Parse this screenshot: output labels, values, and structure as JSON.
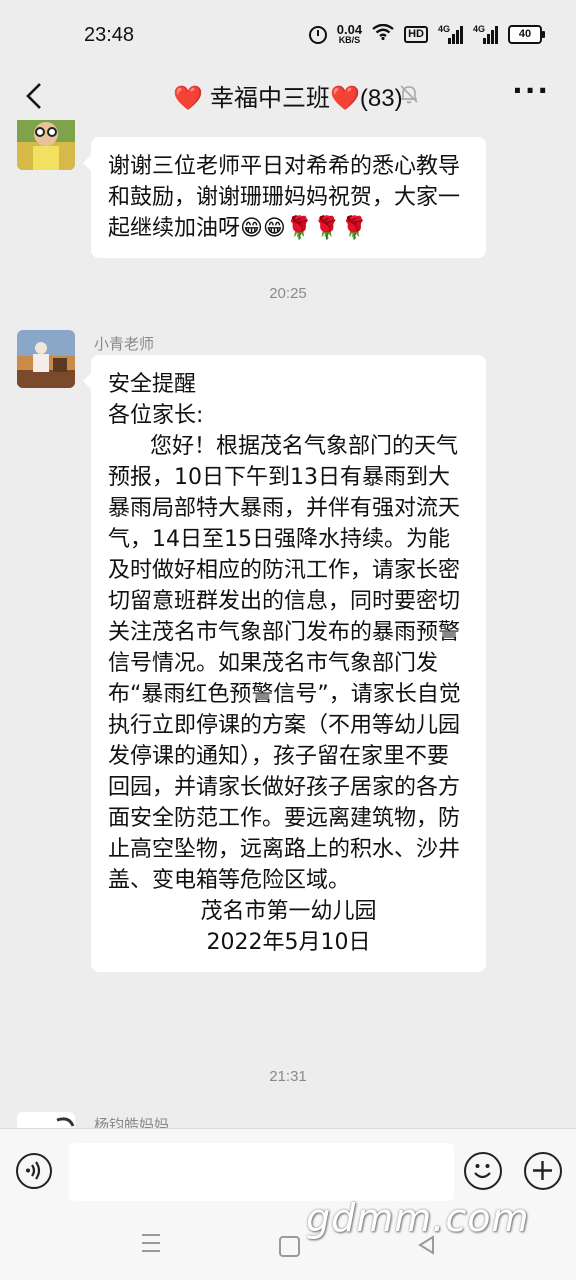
{
  "status_bar": {
    "time": "23:48",
    "net_speed_value": "0.04",
    "net_speed_unit": "KB/S",
    "hd_label": "HD",
    "sig1_label": "4G",
    "sig2_label": "4G",
    "battery": "40"
  },
  "header": {
    "title_heart_left": "❤️",
    "title_text": "幸福中三班",
    "title_heart_right": "❤️",
    "member_count": "(83)",
    "more_label": "···"
  },
  "messages": [
    {
      "sender": "",
      "text": "谢谢三位老师平日对希希的悉心教导和鼓励，谢谢珊珊妈妈祝贺，大家一起继续加油呀😁😁🌹🌹🌹"
    },
    {
      "timestamp": "20:25",
      "sender": "小青老师",
      "text": "安全提醒\n各位家长:\n      您好！根据茂名气象部门的天气预报，10日下午到13日有暴雨到大暴雨局部特大暴雨，并伴有强对流天气，14日至15日强降水持续。为能及时做好相应的防汛工作，请家长密切留意班群发出的信息，同时要密切关注茂名市气象部门发布的暴雨预警信号情况。如果茂名市气象部门发布“暴雨红色预警信号”，请家长自觉执行立即停课的方案（不用等幼儿园发停课的通知），孩子留在家里不要回园，并请家长做好孩子居家的各方面安全防范工作。要远离建筑物，防止高空坠物，远离路上的积水、沙井盖、变电箱等危险区域。\n",
      "signature_org": "茂名市第一幼儿园",
      "signature_date": "2022年5月10日"
    },
    {
      "timestamp": "21:31",
      "sender": "杨钧皓妈妈"
    }
  ],
  "input": {
    "placeholder": ""
  },
  "watermark": "gdmm.com",
  "colors": {
    "background": "#ededed",
    "bubble": "#ffffff",
    "heart": "#e02020",
    "meta_text": "#8a8a8a"
  }
}
